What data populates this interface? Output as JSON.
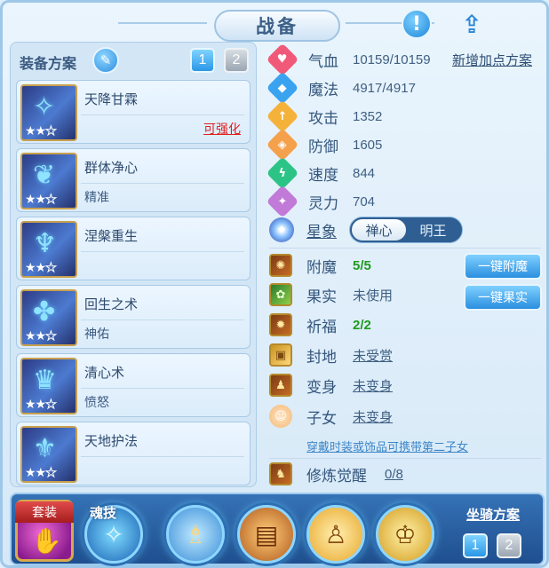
{
  "window": {
    "title": "战备"
  },
  "header": {
    "warn_icon": "exclamation-icon",
    "share_icon": "share-icon"
  },
  "equipment": {
    "label": "装备方案",
    "pages": [
      "1",
      "2"
    ],
    "active_page": "1"
  },
  "skills": [
    {
      "name": "天降甘霖",
      "sub": "",
      "action": "可强化",
      "stars": 2,
      "icon": "bow-icon",
      "glyph": "✧"
    },
    {
      "name": "群体净心",
      "sub": "精准",
      "action": "",
      "stars": 2,
      "icon": "feather-icon",
      "glyph": "❦"
    },
    {
      "name": "涅槃重生",
      "sub": "",
      "action": "",
      "stars": 2,
      "icon": "figure-icon",
      "glyph": "♆"
    },
    {
      "name": "回生之术",
      "sub": "神佑",
      "action": "",
      "stars": 2,
      "icon": "heal-icon",
      "glyph": "✤"
    },
    {
      "name": "清心术",
      "sub": "愤怒",
      "action": "",
      "stars": 2,
      "icon": "crown-icon",
      "glyph": "♛"
    },
    {
      "name": "天地护法",
      "sub": "",
      "action": "",
      "stars": 2,
      "icon": "shield-icon",
      "glyph": "⚜"
    }
  ],
  "stats": [
    {
      "label": "气血",
      "value": "10159/10159",
      "icon": "heart-icon",
      "color": "#f05a78",
      "glyph": "♥"
    },
    {
      "label": "魔法",
      "value": "4917/4917",
      "icon": "mana-icon",
      "color": "#3aa3f0",
      "glyph": "◆"
    },
    {
      "label": "攻击",
      "value": "1352",
      "icon": "attack-icon",
      "color": "#f5b23a",
      "glyph": "↑"
    },
    {
      "label": "防御",
      "value": "1605",
      "icon": "defense-icon",
      "color": "#f5a04a",
      "glyph": "◈"
    },
    {
      "label": "速度",
      "value": "844",
      "icon": "speed-icon",
      "color": "#2cc486",
      "glyph": "ϟ"
    },
    {
      "label": "灵力",
      "value": "704",
      "icon": "spirit-icon",
      "color": "#c27ad8",
      "glyph": "✦"
    }
  ],
  "add_plan_link": "新增加点方案",
  "star_sign": {
    "label": "星象",
    "options": [
      "禅心",
      "明王"
    ],
    "selected": "禅心"
  },
  "extras": [
    {
      "label": "附魔",
      "value": "5/5",
      "style": "green",
      "icon": "enchant-icon",
      "glyph": "✺"
    },
    {
      "label": "果实",
      "value": "未使用",
      "style": "plain",
      "icon": "fruit-icon",
      "glyph": "✿"
    },
    {
      "label": "祈福",
      "value": "2/2",
      "style": "green",
      "icon": "bless-icon",
      "glyph": "✹"
    },
    {
      "label": "封地",
      "value": "未受赏",
      "style": "link",
      "icon": "fief-icon",
      "glyph": "▣"
    },
    {
      "label": "变身",
      "value": "未变身",
      "style": "link",
      "icon": "transform-icon",
      "glyph": "♟"
    },
    {
      "label": "子女",
      "value": "未变身",
      "style": "link",
      "icon": "child-icon",
      "glyph": "☺"
    }
  ],
  "child_note": "穿戴时装或饰品可携带第二子女",
  "cultivation": {
    "label": "修炼觉醒",
    "value": "0/8",
    "icon": "cultivation-icon",
    "glyph": "♞"
  },
  "buttons": {
    "one_click_enchant": "一键附魔",
    "one_click_fruit": "一键果实"
  },
  "bottom": {
    "suit_label": "套装",
    "soul_label": "魂技",
    "mount_label": "坐骑方案",
    "mount_pages": [
      "1",
      "2"
    ],
    "slots": [
      {
        "name": "soul-skill-slot",
        "glyph": "✧"
      },
      {
        "name": "figure-slot",
        "glyph": "♗"
      },
      {
        "name": "scroll-slot",
        "glyph": "▤"
      },
      {
        "name": "monk-slot",
        "glyph": "♙"
      },
      {
        "name": "golden-figure-slot",
        "glyph": "♔"
      }
    ]
  }
}
